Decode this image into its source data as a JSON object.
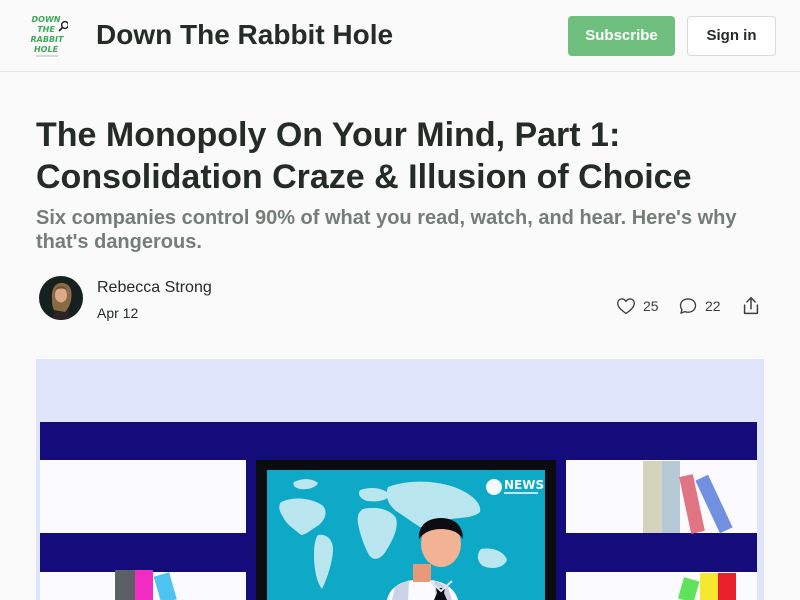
{
  "header": {
    "logo_text": [
      "DOWN",
      "THE",
      "RABBIT",
      "HOLE"
    ],
    "logo_icon": "magnifier-icon",
    "site_title": "Down The Rabbit Hole",
    "subscribe_label": "Subscribe",
    "signin_label": "Sign in"
  },
  "post": {
    "title": "The Monopoly On Your Mind, Part 1: Consolidation Craze & Illusion of Choice",
    "subtitle": "Six companies control 90% of what you read, watch, and hear. Here's why that's dangerous.",
    "author": "Rebecca Strong",
    "date": "Apr 12",
    "likes": "25",
    "comments": "22",
    "hero_badge": "NEWS"
  },
  "colors": {
    "accent": "#6fbf7f",
    "hero_bg": "#dfe6fb",
    "shelf": "#130c7a",
    "screen": "#0fa9c8"
  }
}
